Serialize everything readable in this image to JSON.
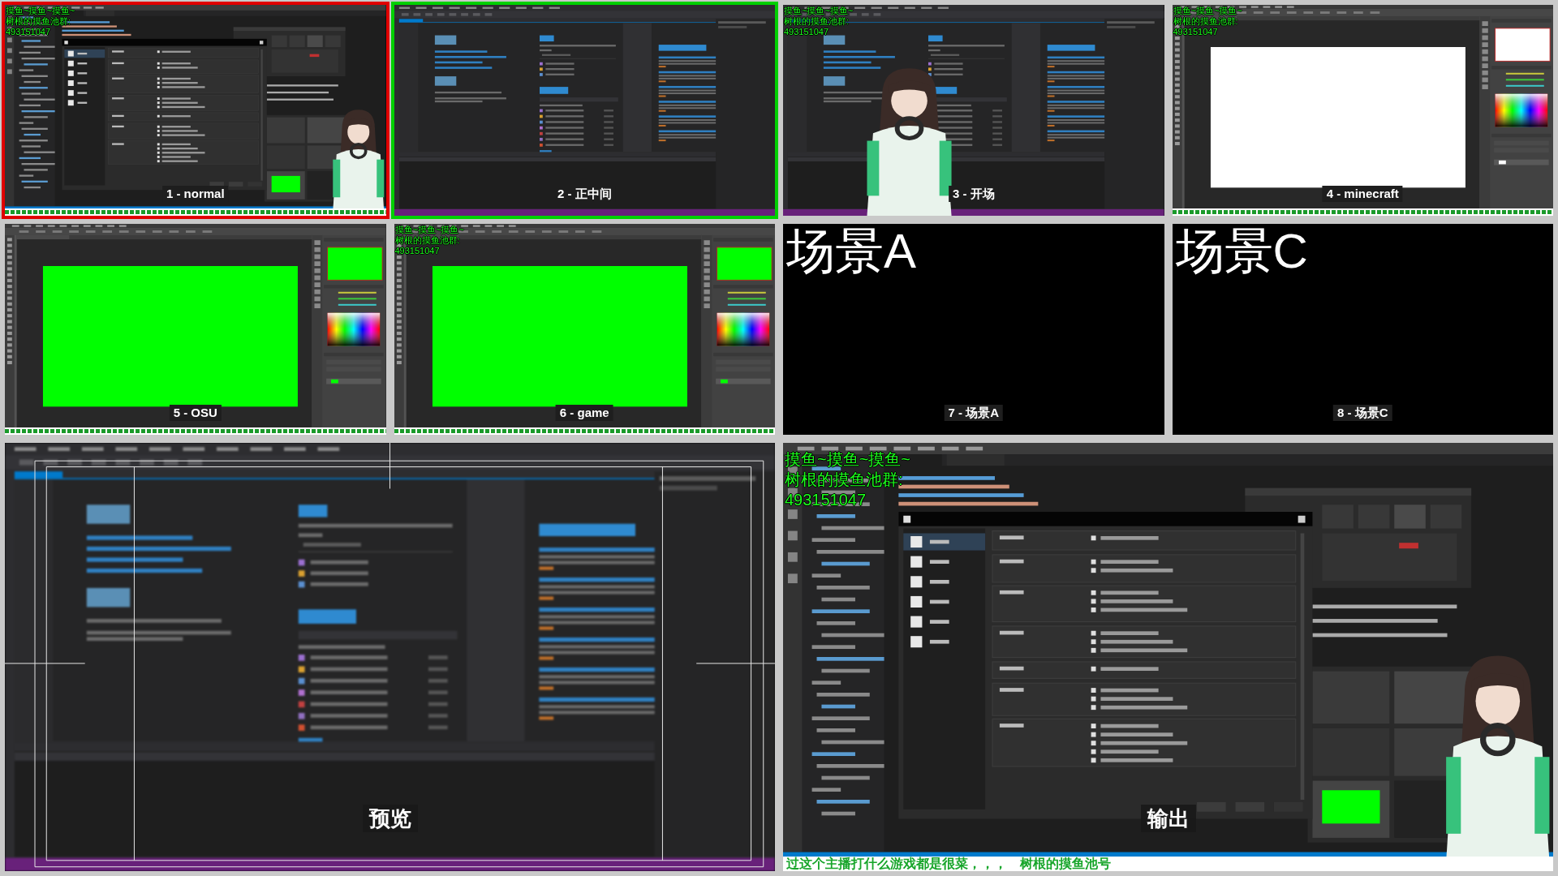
{
  "tiles": [
    {
      "label": "1 - normal",
      "on_program": true,
      "on_preview": false,
      "frame": {
        "kind": "desktop",
        "figure": true,
        "ticker": true,
        "caption": [
          "摸鱼~摸鱼~摸鱼~",
          "树根的摸鱼池群:",
          "493151047"
        ]
      }
    },
    {
      "label": "2 - 正中间",
      "on_program": false,
      "on_preview": true,
      "frame": {
        "kind": "editor",
        "figure": false,
        "ticker": false
      }
    },
    {
      "label": "3 - 开场",
      "on_program": false,
      "on_preview": false,
      "frame": {
        "kind": "editor",
        "figure": true,
        "ticker": false,
        "caption": [
          "摸鱼~摸鱼~摸鱼~",
          "树根的摸鱼池群:",
          "493151047"
        ]
      }
    },
    {
      "label": "4 - minecraft",
      "on_program": false,
      "on_preview": false,
      "frame": {
        "kind": "paint",
        "color": "#ffffff",
        "figure": false,
        "ticker": true,
        "caption": [
          "摸鱼~摸鱼~摸鱼~",
          "树根的摸鱼池群:",
          "493151047"
        ]
      }
    },
    {
      "label": "5 - OSU",
      "on_program": false,
      "on_preview": false,
      "frame": {
        "kind": "paint",
        "color": "#00ff00",
        "figure": false,
        "ticker": true
      }
    },
    {
      "label": "6 - game",
      "on_program": false,
      "on_preview": false,
      "frame": {
        "kind": "paint",
        "color": "#00ff00",
        "figure": false,
        "ticker": true,
        "caption": [
          "摸鱼~摸鱼~摸鱼~",
          "树根的摸鱼池群:",
          "493151047"
        ]
      }
    },
    {
      "label": "7 - 场景A",
      "on_program": false,
      "on_preview": false,
      "frame": {
        "kind": "text",
        "text": "场景A",
        "figure": false,
        "ticker": false
      }
    },
    {
      "label": "8 - 场景C",
      "on_program": false,
      "on_preview": false,
      "frame": {
        "kind": "text",
        "text": "场景C",
        "figure": false,
        "ticker": false
      }
    }
  ],
  "preview": {
    "label": "预览",
    "frame": {
      "kind": "editor",
      "figure": false,
      "ticker": false
    }
  },
  "output": {
    "label": "输出",
    "frame": {
      "kind": "desktop",
      "figure": true,
      "ticker": true,
      "ticker_text": "过这个主播打什么游戏都是很菜，，，　树根的摸鱼池号",
      "caption": [
        "摸鱼~摸鱼~摸鱼~",
        "树根的摸鱼池群:",
        "493151047"
      ]
    }
  }
}
